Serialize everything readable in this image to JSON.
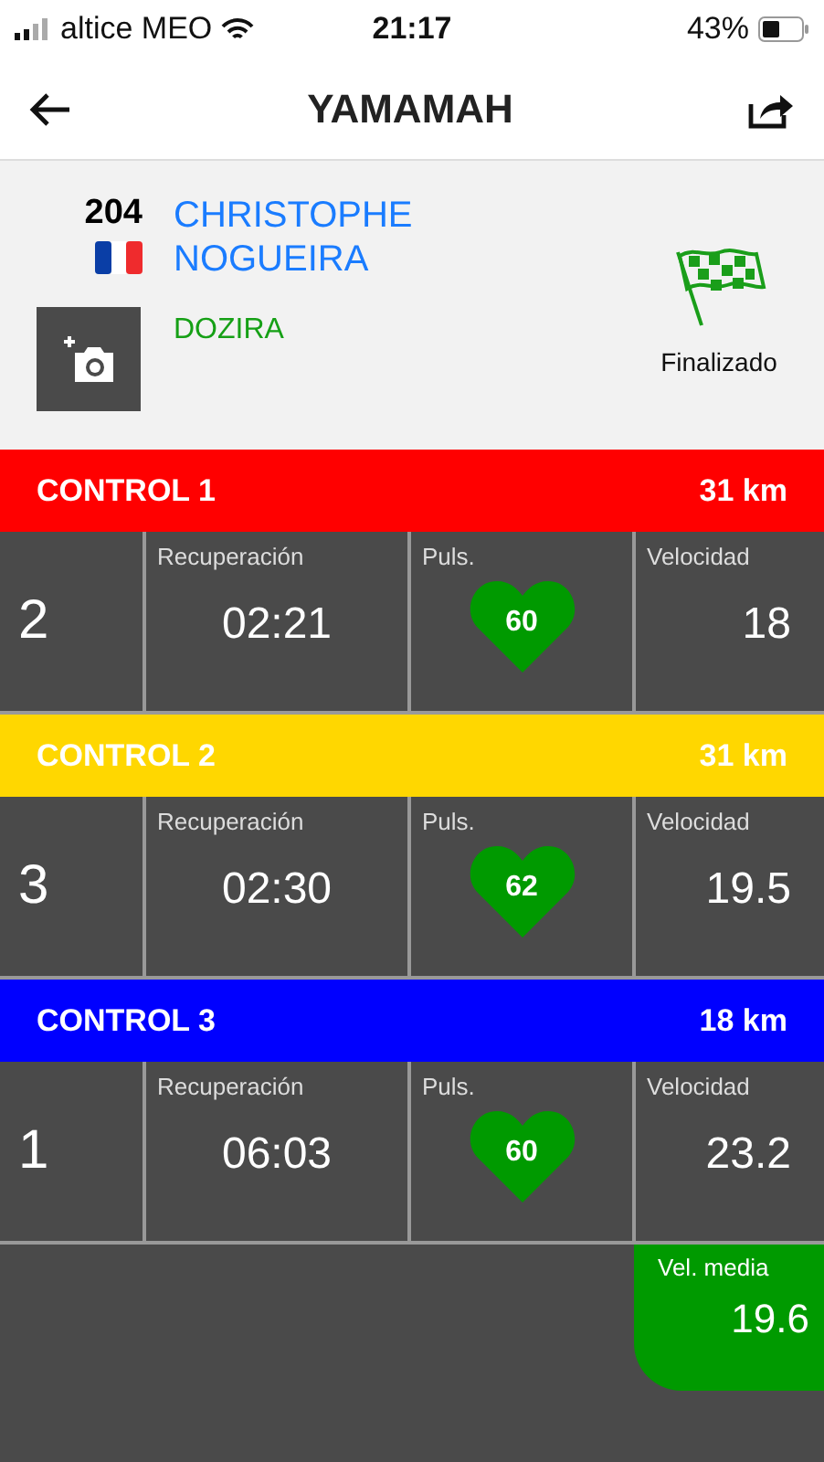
{
  "status_bar": {
    "carrier": "altice MEO",
    "time": "21:17",
    "battery": "43%"
  },
  "nav": {
    "title": "YAMAMAH"
  },
  "rider": {
    "number": "204",
    "first_name": "CHRISTOPHE",
    "last_name": "NOGUEIRA",
    "horse": "DOZIRA",
    "status": "Finalizado"
  },
  "controls": [
    {
      "name": "CONTROL 1",
      "distance": "31 km",
      "color": "#ff0000",
      "rank": "2",
      "recovery_label": "Recuperación",
      "recovery": "02:21",
      "pulse_label": "Puls.",
      "pulse": "60",
      "speed_label": "Velocidad",
      "speed": "18"
    },
    {
      "name": "CONTROL 2",
      "distance": "31 km",
      "color": "#ffd700",
      "rank": "3",
      "recovery_label": "Recuperación",
      "recovery": "02:30",
      "pulse_label": "Puls.",
      "pulse": "62",
      "speed_label": "Velocidad",
      "speed": "19.5"
    },
    {
      "name": "CONTROL 3",
      "distance": "18 km",
      "color": "#0000ff",
      "rank": "1",
      "recovery_label": "Recuperación",
      "recovery": "06:03",
      "pulse_label": "Puls.",
      "pulse": "60",
      "speed_label": "Velocidad",
      "speed": "23.2"
    }
  ],
  "average": {
    "label": "Vel. media",
    "value": "19.6"
  }
}
